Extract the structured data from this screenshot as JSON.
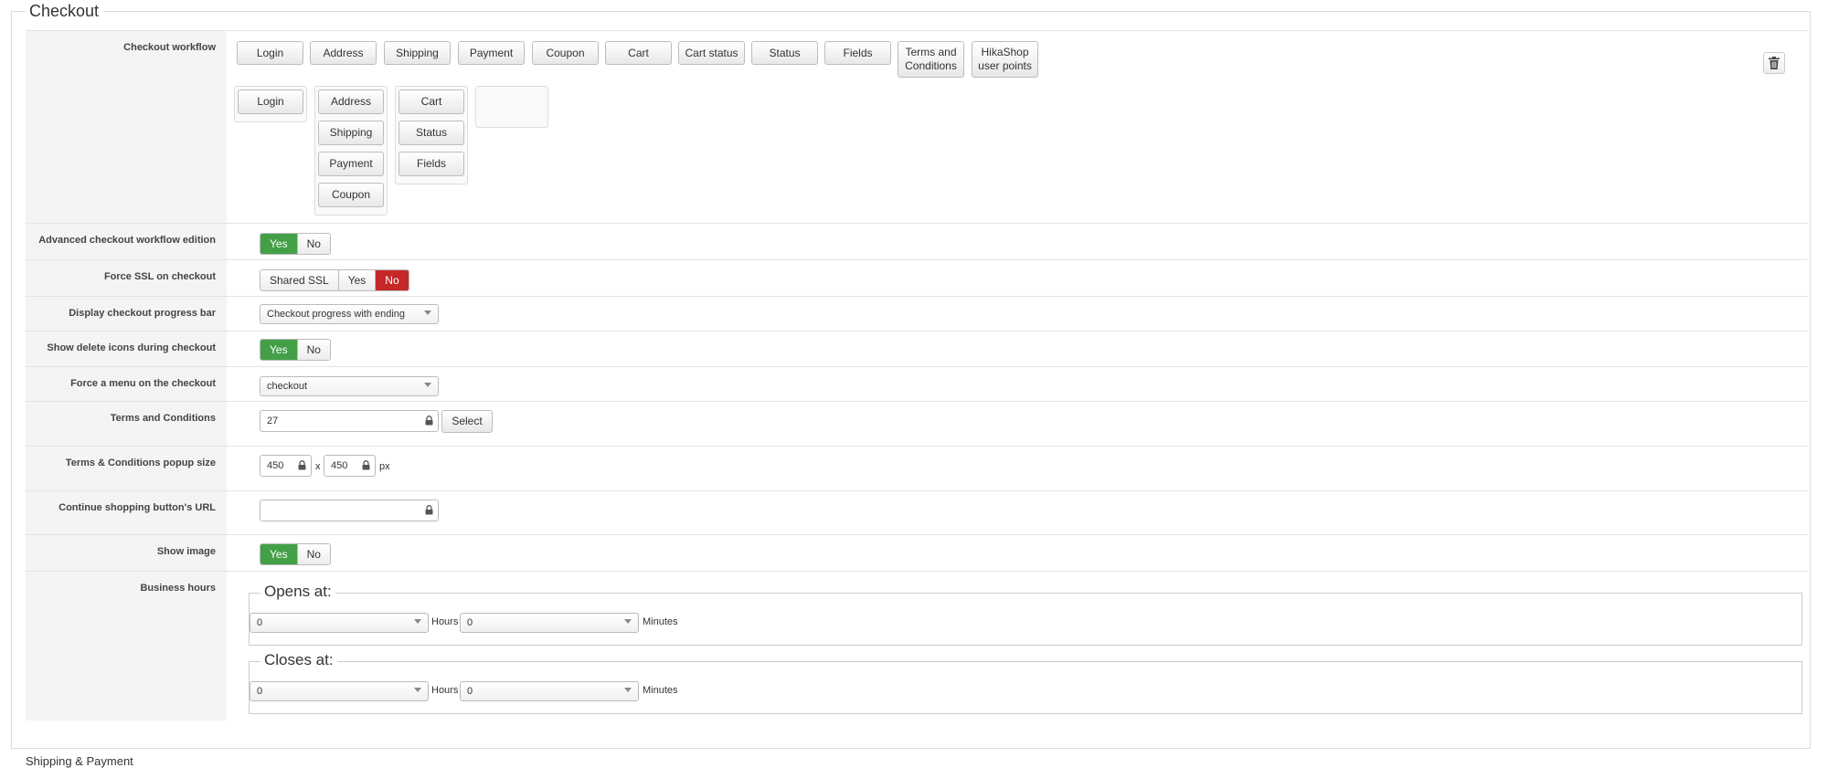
{
  "section_title": "Checkout",
  "next_section_title": "Shipping & Payment",
  "workflow": {
    "label": "Checkout workflow",
    "available_steps": [
      "Login",
      "Address",
      "Shipping",
      "Payment",
      "Coupon",
      "Cart",
      "Cart status",
      "Status",
      "Fields",
      "Terms and Conditions",
      "HikaShop user points"
    ],
    "columns": [
      [
        "Login"
      ],
      [
        "Address",
        "Shipping",
        "Payment",
        "Coupon"
      ],
      [
        "Cart",
        "Status",
        "Fields"
      ],
      []
    ]
  },
  "advanced_workflow": {
    "label": "Advanced checkout workflow edition",
    "yes": "Yes",
    "no": "No",
    "selected": "yes"
  },
  "force_ssl": {
    "label": "Force SSL on checkout",
    "options": [
      "Shared SSL",
      "Yes",
      "No"
    ],
    "selected": "No"
  },
  "progress_bar": {
    "label": "Display checkout progress bar",
    "value": "Checkout progress with ending"
  },
  "delete_icons": {
    "label": "Show delete icons during checkout",
    "yes": "Yes",
    "no": "No",
    "selected": "yes"
  },
  "force_menu": {
    "label": "Force a menu on the checkout",
    "value": "checkout"
  },
  "terms": {
    "label": "Terms and Conditions",
    "value": "27",
    "select_label": "Select"
  },
  "terms_popup": {
    "label": "Terms & Conditions popup size",
    "width": "450",
    "height": "450",
    "separator": "x",
    "unit": "px"
  },
  "continue_url": {
    "label": "Continue shopping button's URL",
    "value": ""
  },
  "show_image": {
    "label": "Show image",
    "yes": "Yes",
    "no": "No",
    "selected": "yes"
  },
  "business_hours": {
    "label": "Business hours",
    "opens": {
      "legend": "Opens at:",
      "hours": "0",
      "hours_label": "Hours",
      "minutes": "0",
      "minutes_label": "Minutes"
    },
    "closes": {
      "legend": "Closes at:",
      "hours": "0",
      "hours_label": "Hours",
      "minutes": "0",
      "minutes_label": "Minutes"
    }
  },
  "colors": {
    "yes_active": "#43a047",
    "no_active": "#c62828"
  }
}
